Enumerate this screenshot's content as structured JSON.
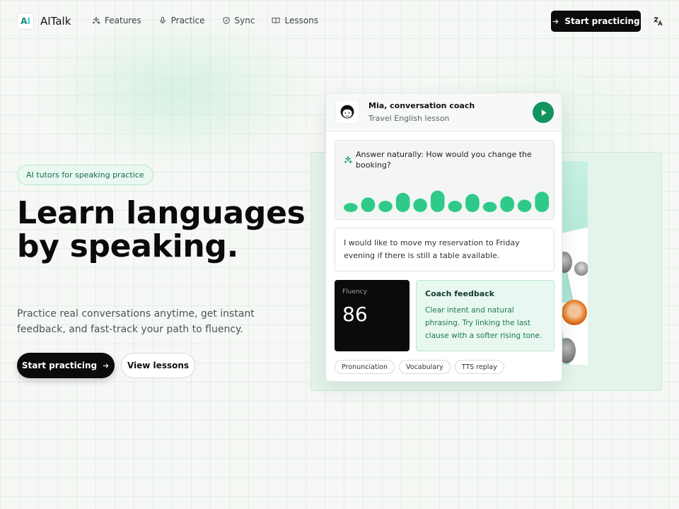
{
  "brand": {
    "name": "AITalk",
    "logo_letters": "A",
    "logo_letter_i": "I"
  },
  "nav": {
    "items": [
      {
        "label": "Features",
        "icon": "sparkles-icon"
      },
      {
        "label": "Practice",
        "icon": "microphone-icon"
      },
      {
        "label": "Sync",
        "icon": "shield-icon"
      },
      {
        "label": "Lessons",
        "icon": "book-icon"
      }
    ],
    "cta_label": "Start practicing"
  },
  "hero": {
    "badge": "AI tutors for speaking practice",
    "title": "Learn languages by speaking.",
    "subtitle": "Practice real conversations anytime, get instant feedback, and fast-track your path to fluency.",
    "primary_label": "Start practicing",
    "secondary_label": "View lessons"
  },
  "card": {
    "coach_name": "Mia, conversation coach",
    "lesson": "Travel English lesson",
    "prompt": "Answer naturally: How would you change the booking?",
    "waveform_levels": [
      0.4,
      0.65,
      0.5,
      0.85,
      0.6,
      0.95,
      0.5,
      0.8,
      0.45,
      0.7,
      0.55,
      0.9
    ],
    "reply": "I would like to move my reservation to Friday evening if there is still a table available.",
    "fluency_label": "Fluency",
    "fluency_score": "86",
    "feedback_title": "Coach feedback",
    "feedback_body": "Clear intent and natural phrasing. Try linking the last clause with a softer rising tone.",
    "chips": [
      "Pronunciation",
      "Vocabulary",
      "TTS replay"
    ]
  },
  "colors": {
    "accent": "#11945f",
    "wave": "#2fc98a",
    "dark": "#0b0b0b",
    "feedback_bg": "#e8f7ef"
  }
}
